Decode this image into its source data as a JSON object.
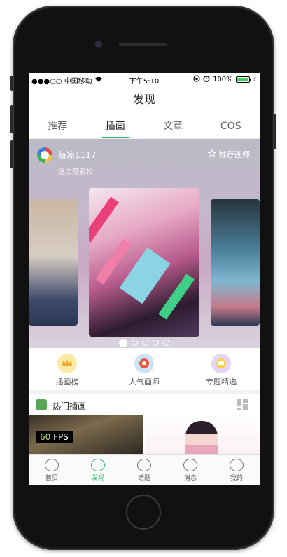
{
  "status": {
    "carrier": "●●●○○ 中国移动",
    "time": "下午5:10",
    "battery": "100%"
  },
  "nav": {
    "title": "发现"
  },
  "tabs": [
    {
      "label": "推荐",
      "active": false
    },
    {
      "label": "插画",
      "active": true
    },
    {
      "label": "文章",
      "active": false
    },
    {
      "label": "COS",
      "active": false
    }
  ],
  "featured": {
    "artist_name": "赫凉1117",
    "artist_subtitle": "迷之签名栏",
    "recommend_label": "推荐画师",
    "page_count": 5,
    "current_page": 1
  },
  "quick_links": [
    {
      "label": "插画榜",
      "icon": "crown-icon",
      "color": "#f7d24a"
    },
    {
      "label": "人气画师",
      "icon": "popular-artist-icon",
      "color": "#5aa2e6"
    },
    {
      "label": "专题精选",
      "icon": "topic-icon",
      "color": "#9b6ad8"
    }
  ],
  "hot": {
    "title": "热门插画"
  },
  "fps": {
    "value": "60",
    "unit": "FPS"
  },
  "tabbar": [
    {
      "label": "首页",
      "icon": "home-planet-icon",
      "active": false
    },
    {
      "label": "发现",
      "icon": "discover-icon",
      "active": true
    },
    {
      "label": "话题",
      "icon": "topic-bubble-icon",
      "active": false
    },
    {
      "label": "消息",
      "icon": "bell-icon",
      "active": false
    },
    {
      "label": "我的",
      "icon": "profile-icon",
      "active": false
    }
  ],
  "colors": {
    "accent": "#2bbd6e"
  }
}
